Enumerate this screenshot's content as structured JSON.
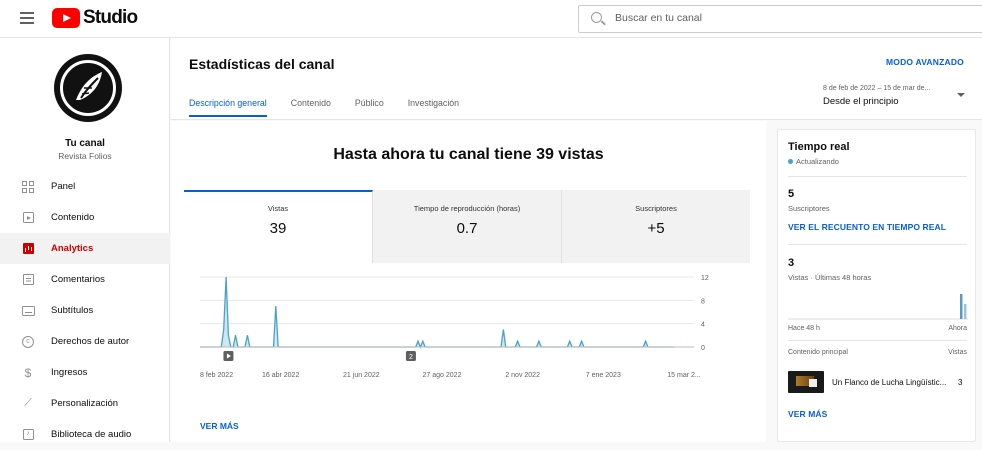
{
  "topbar": {
    "logo_text": "Studio",
    "search_placeholder": "Buscar en tu canal"
  },
  "sidebar": {
    "channel_name": "Tu canal",
    "channel_subtitle": "Revista Folios",
    "items": [
      {
        "label": "Panel",
        "icon": "dashboard-icon"
      },
      {
        "label": "Contenido",
        "icon": "content-icon"
      },
      {
        "label": "Analytics",
        "icon": "analytics-icon",
        "active": true
      },
      {
        "label": "Comentarios",
        "icon": "comments-icon"
      },
      {
        "label": "Subtítulos",
        "icon": "subtitles-icon"
      },
      {
        "label": "Derechos de autor",
        "icon": "copyright-icon"
      },
      {
        "label": "Ingresos",
        "icon": "dollar-icon"
      },
      {
        "label": "Personalización",
        "icon": "wand-icon"
      },
      {
        "label": "Biblioteca de audio",
        "icon": "audio-library-icon"
      }
    ]
  },
  "header": {
    "title": "Estadísticas del canal",
    "advanced_mode": "MODO AVANZADO",
    "tabs": [
      "Descripción general",
      "Contenido",
      "Público",
      "Investigación"
    ],
    "date_range": "8 de feb de 2022 – 15 de mar de...",
    "date_selection": "Desde el principio"
  },
  "overview": {
    "headline": "Hasta ahora tu canal tiene 39 vistas",
    "metrics": [
      {
        "label": "Vistas",
        "value": "39"
      },
      {
        "label": "Tiempo de reproducción (horas)",
        "value": "0.7"
      },
      {
        "label": "Suscriptores",
        "value": "+5"
      }
    ],
    "see_more": "VER MÁS"
  },
  "chart_data": {
    "type": "line",
    "x_tick_labels": [
      "8 feb 2022",
      "16 abr 2022",
      "21 jun 2022",
      "27 ago 2022",
      "2 nov 2022",
      "7 ene 2023",
      "15 mar 2..."
    ],
    "y_ticks": [
      "12",
      "8",
      "4",
      "0"
    ],
    "ylim": [
      0,
      12
    ],
    "series": [
      {
        "values": [
          [
            0.0,
            0
          ],
          [
            0.045,
            0
          ],
          [
            0.05,
            3
          ],
          [
            0.055,
            12
          ],
          [
            0.06,
            2
          ],
          [
            0.065,
            0
          ],
          [
            0.07,
            0
          ],
          [
            0.075,
            2
          ],
          [
            0.08,
            0
          ],
          [
            0.095,
            0
          ],
          [
            0.1,
            2
          ],
          [
            0.105,
            0
          ],
          [
            0.155,
            0
          ],
          [
            0.16,
            7
          ],
          [
            0.165,
            0
          ],
          [
            0.455,
            0
          ],
          [
            0.46,
            1
          ],
          [
            0.465,
            0
          ],
          [
            0.47,
            1
          ],
          [
            0.475,
            0
          ],
          [
            0.635,
            0
          ],
          [
            0.64,
            3
          ],
          [
            0.645,
            0
          ],
          [
            0.665,
            0
          ],
          [
            0.67,
            1
          ],
          [
            0.675,
            0
          ],
          [
            0.71,
            0
          ],
          [
            0.715,
            1
          ],
          [
            0.72,
            0
          ],
          [
            0.775,
            0
          ],
          [
            0.78,
            1
          ],
          [
            0.785,
            0
          ],
          [
            0.8,
            0
          ],
          [
            0.805,
            1
          ],
          [
            0.81,
            0
          ],
          [
            0.935,
            0
          ],
          [
            0.94,
            1
          ],
          [
            0.945,
            0
          ],
          [
            1.0,
            0
          ]
        ]
      }
    ],
    "markers": [
      {
        "label": "",
        "x": 0.06
      },
      {
        "label": "2",
        "x": 0.445
      }
    ]
  },
  "realtime": {
    "title": "Tiempo real",
    "status": "Actualizando",
    "subscribers_value": "5",
    "subscribers_label": "Suscriptores",
    "live_count_link": "VER EL RECUENTO EN TIEMPO REAL",
    "views_value": "3",
    "views_label": "Vistas · Últimas 48 horas",
    "axis_left": "Hace 48 h",
    "axis_right": "Ahora",
    "top_content_label": "Contenido principal",
    "views_col_label": "Vistas",
    "top_video_title": "Un Flanco de Lucha Lingüístic...",
    "top_video_views": "3",
    "see_more": "VER MÁS"
  }
}
